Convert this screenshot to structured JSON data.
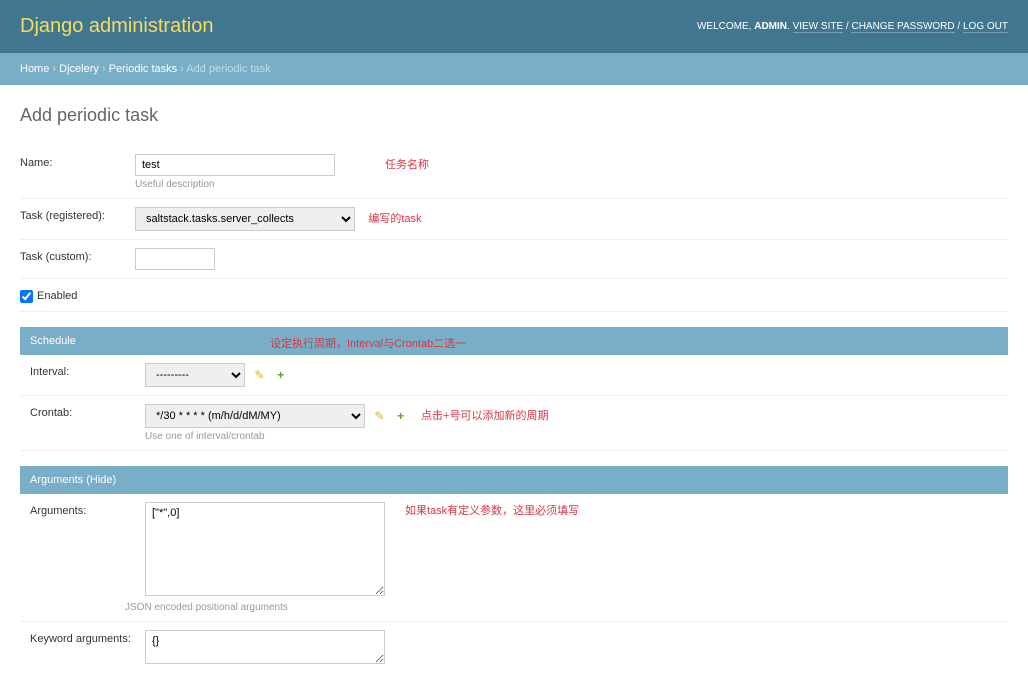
{
  "header": {
    "site_name": "Django administration",
    "welcome": "WELCOME,",
    "username": "ADMIN",
    "view_site": "VIEW SITE",
    "change_password": "CHANGE PASSWORD",
    "logout": "LOG OUT"
  },
  "breadcrumbs": {
    "home": "Home",
    "app": "Djcelery",
    "model": "Periodic tasks",
    "current": "Add periodic task"
  },
  "page_title": "Add periodic task",
  "fields": {
    "name": {
      "label": "Name:",
      "value": "test",
      "help": "Useful description",
      "annotation": "任务名称"
    },
    "task_registered": {
      "label": "Task (registered):",
      "value": "saltstack.tasks.server_collects",
      "annotation": "编写的task"
    },
    "task_custom": {
      "label": "Task (custom):",
      "value": ""
    },
    "enabled": {
      "label": "Enabled",
      "checked": true
    }
  },
  "schedule": {
    "heading": "Schedule",
    "heading_annotation": "设定执行周期，Interval与Crontab二选一",
    "interval": {
      "label": "Interval:",
      "value": "---------"
    },
    "crontab": {
      "label": "Crontab:",
      "value": "*/30 * * * * (m/h/d/dM/MY)",
      "help": "Use one of interval/crontab",
      "annotation": "点击+号可以添加新的周期"
    }
  },
  "arguments": {
    "heading": "Arguments (Hide)",
    "args": {
      "label": "Arguments:",
      "value": "[\"*\",0]",
      "help": "JSON encoded positional arguments",
      "annotation": "如果task有定义参数，这里必须填写"
    },
    "kwargs": {
      "label": "Keyword arguments:",
      "value": "{}"
    }
  }
}
